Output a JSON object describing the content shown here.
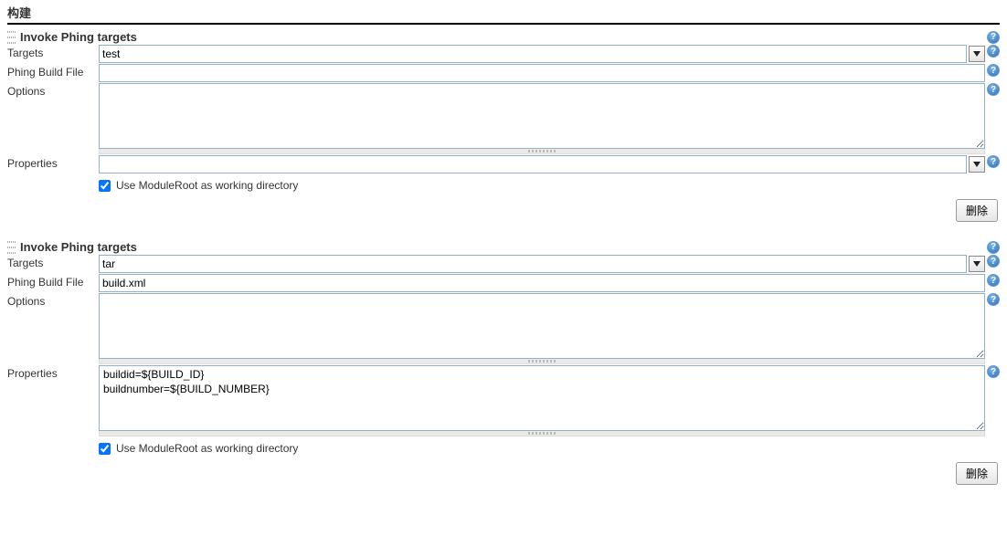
{
  "sectionTitle": "构建",
  "helpGlyph": "?",
  "blocks": [
    {
      "title": "Invoke Phing targets",
      "targets": {
        "label": "Targets",
        "value": "test"
      },
      "buildFile": {
        "label": "Phing Build File",
        "value": ""
      },
      "options": {
        "label": "Options",
        "value": ""
      },
      "properties": {
        "label": "Properties",
        "value": ""
      },
      "useModuleRoot": {
        "label": "Use ModuleRoot as working directory",
        "checked": true
      },
      "deleteLabel": "删除"
    },
    {
      "title": "Invoke Phing targets",
      "targets": {
        "label": "Targets",
        "value": "tar"
      },
      "buildFile": {
        "label": "Phing Build File",
        "value": "build.xml"
      },
      "options": {
        "label": "Options",
        "value": ""
      },
      "properties": {
        "label": "Properties",
        "value": "buildid=${BUILD_ID}\nbuildnumber=${BUILD_NUMBER}"
      },
      "useModuleRoot": {
        "label": "Use ModuleRoot as working directory",
        "checked": true
      },
      "deleteLabel": "删除"
    }
  ]
}
